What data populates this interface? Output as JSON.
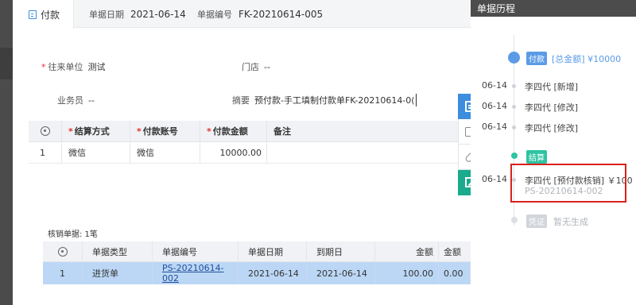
{
  "tab": {
    "label": "付款"
  },
  "header": {
    "date_label": "单据日期",
    "date_value": "2021-06-14",
    "number_label": "单据编号",
    "number_value": "FK-20210614-005"
  },
  "form": {
    "partner_label": "往来单位",
    "partner_value": "测试",
    "store_label": "门店",
    "store_value": "--",
    "clerk_label": "业务员",
    "clerk_value": "--",
    "memo_label": "摘要",
    "memo_value": "预付款-手工填制付款单FK-20210614-0("
  },
  "payment_grid": {
    "headers": [
      "结算方式",
      "付款账号",
      "付款金额",
      "备注"
    ],
    "rows": [
      {
        "index": "1",
        "method": "微信",
        "account": "微信",
        "amount": "10000.00",
        "remark": ""
      }
    ]
  },
  "write_off": {
    "label": "核销单据: 1笔",
    "headers": [
      "单据类型",
      "单据编号",
      "单据日期",
      "到期日",
      "金额",
      "金额"
    ],
    "rows": [
      {
        "index": "1",
        "type": "进货单",
        "number": "PS-20210614-002",
        "date": "2021-06-14",
        "due": "2021-06-14",
        "amount": "100.00",
        "amount2": "0.00"
      }
    ]
  },
  "history": {
    "title": "单据历程",
    "pay_badge": "付款",
    "pay_total": "[总金额] ¥10000",
    "entries": [
      {
        "date": "06-14",
        "text": "李四代 [新增]"
      },
      {
        "date": "06-14",
        "text": "李四代 [修改]"
      },
      {
        "date": "06-14",
        "text": "李四代 [修改]"
      }
    ],
    "settle_badge": "结算",
    "settle_entry": {
      "date": "06-14",
      "text": "李四代 [预付款核销] ￥100",
      "sub": "PS-20210614-002"
    },
    "voucher_badge": "凭证",
    "voucher_text": "暂无生成"
  },
  "colors": {
    "accent": "#3c8dde",
    "green": "#1aaa8c",
    "highlight_row": "#bcd7f5",
    "required": "#e5302b",
    "annotation": "#d9211b"
  }
}
